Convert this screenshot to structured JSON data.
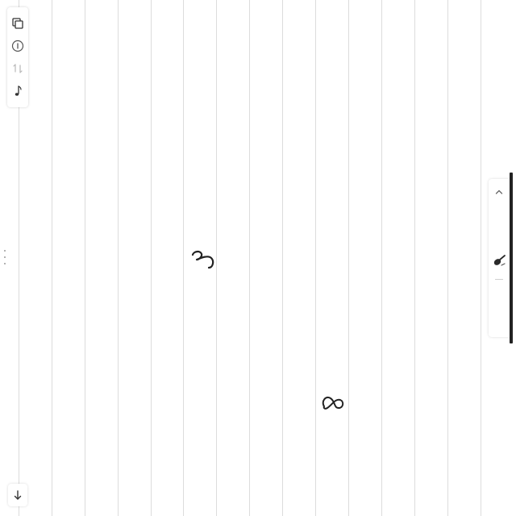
{
  "app": {
    "background": "#ffffff",
    "rule_color": "#dcdcdc"
  },
  "left_toolbar": {
    "items": [
      {
        "icon": "copy-pages-icon"
      },
      {
        "icon": "info-icon"
      },
      {
        "icon": "undo-redo-icon"
      },
      {
        "icon": "audio-note-icon"
      }
    ]
  },
  "bottom_left": {
    "icon": "arrow-down-icon"
  },
  "right_panel": {
    "items": [
      {
        "icon": "chevron-up-icon"
      },
      {
        "icon": "pen-tool-icon"
      }
    ],
    "accent": "#222222"
  },
  "ink_strokes": [
    {
      "name": "handwritten-stroke-3"
    },
    {
      "name": "handwritten-stroke-8"
    }
  ]
}
